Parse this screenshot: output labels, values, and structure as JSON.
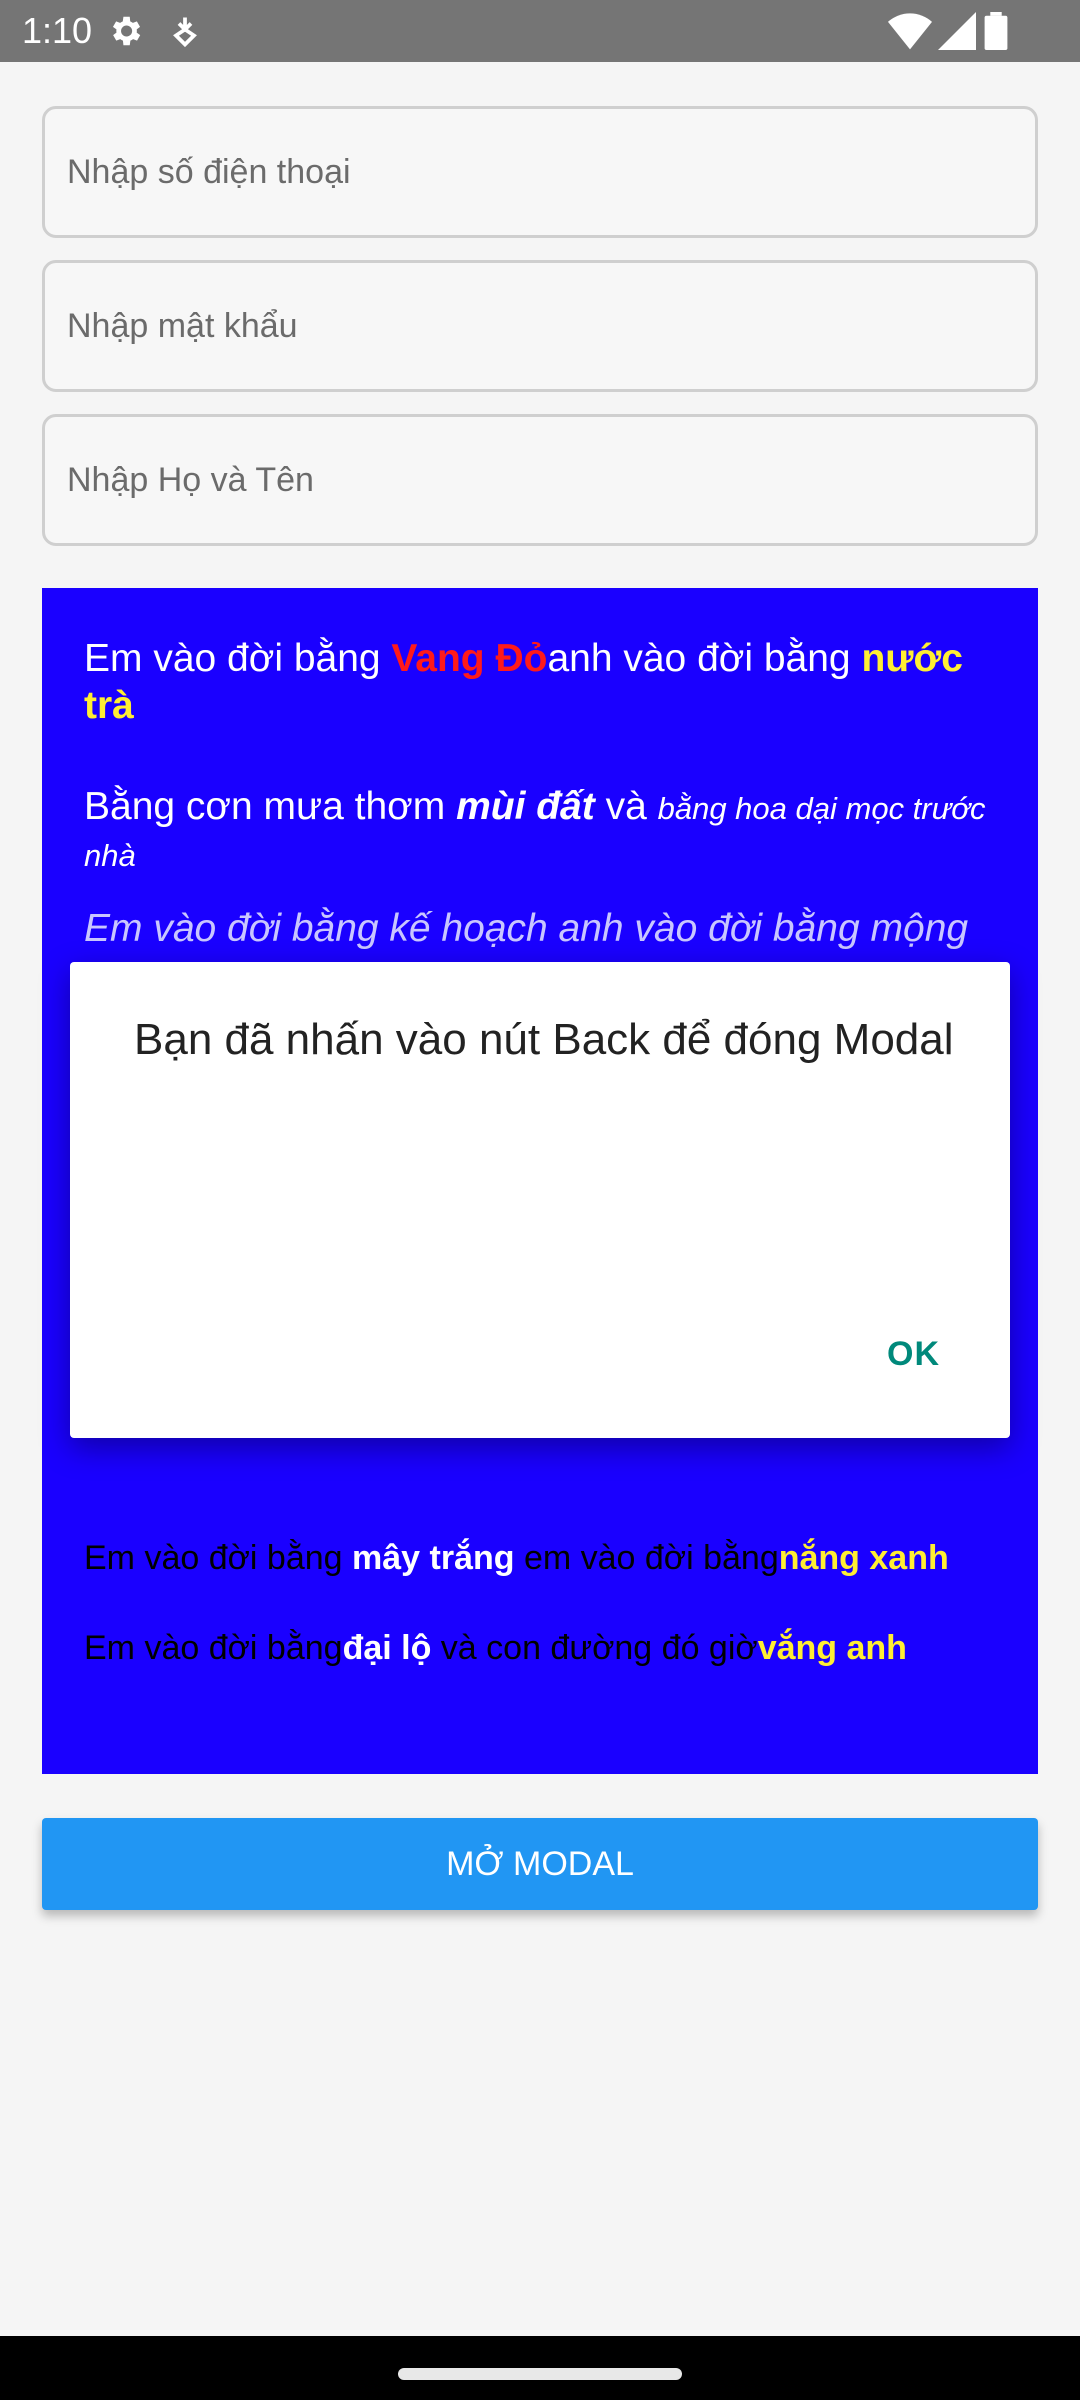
{
  "status_bar": {
    "time": "1:10",
    "icons": [
      "gear-icon",
      "data-saver-icon",
      "wifi-icon",
      "signal-icon",
      "battery-icon"
    ]
  },
  "inputs": {
    "phone": {
      "placeholder": "Nhập số điện thoại",
      "value": ""
    },
    "password": {
      "placeholder": "Nhập mật khẩu",
      "value": ""
    },
    "fullname": {
      "placeholder": "Nhập Họ và Tên",
      "value": ""
    }
  },
  "panel": {
    "background": "#1a00ff",
    "line1": {
      "a": "Em vào đời bằng ",
      "red": "Vang Đỏ",
      "b": "anh vào đời bằng ",
      "yellow": "nước trà"
    },
    "line2": {
      "a": "Bằng cơn mưa thơm ",
      "bold_italic": "mùi đất",
      "b": " và ",
      "small": "bằng hoa dại mọc trước nhà"
    },
    "line3": "Em vào đời bằng kế hoạch anh vào đời bằng mộng",
    "line4": {
      "a": "Em vào đời bằng ",
      "white": "mây trắng",
      "b": " em vào đời bằng",
      "yellow": "nắng xanh"
    },
    "line5": {
      "a": "Em vào đời bằng",
      "white": "đại lộ",
      "b": " và con đường đó giờ",
      "yellow": "vắng anh"
    }
  },
  "modal": {
    "message": "Bạn đã nhấn vào nút Back để đóng Modal",
    "ok_label": "OK"
  },
  "open_modal_button": {
    "label": "MỞ MODAL"
  },
  "colors": {
    "accent": "#2196f3",
    "ok_teal": "#00897b",
    "red_text": "#ff1a1a",
    "yellow_text": "#ffee33"
  }
}
